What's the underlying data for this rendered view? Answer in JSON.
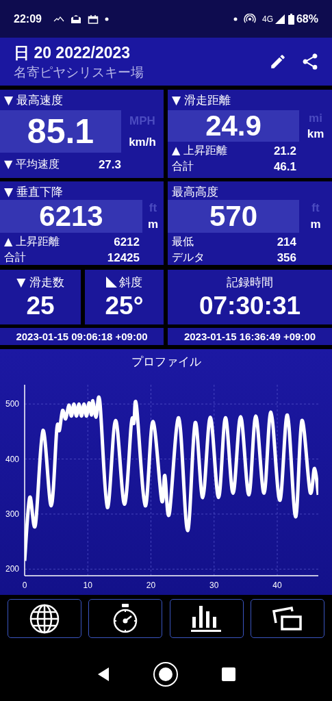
{
  "status_bar": {
    "time": "22:09",
    "network": "4G",
    "battery": "68%"
  },
  "header": {
    "title": "日 20 2022/2023",
    "subtitle": "名寄ピヤシリスキー場"
  },
  "stats": [
    {
      "label": "▼ 最高速度",
      "value": "85.1",
      "units": [
        {
          "label": "MPH",
          "selected": false
        },
        {
          "label": "km/h",
          "selected": true
        }
      ],
      "rows": [
        {
          "label": "▼ 平均速度",
          "value": "27.3"
        }
      ]
    },
    {
      "label": "▼ 滑走距離",
      "value": "24.9",
      "units": [
        {
          "label": "mi",
          "selected": false
        },
        {
          "label": "km",
          "selected": true
        }
      ],
      "rows": [
        {
          "label": "▲ 上昇距離",
          "value": "21.2"
        },
        {
          "label": "合計",
          "value": "46.1"
        }
      ]
    },
    {
      "label": "▼ 垂直下降",
      "value": "6213",
      "units": [
        {
          "label": "ft",
          "selected": false
        },
        {
          "label": "m",
          "selected": true
        }
      ],
      "rows": [
        {
          "label": "▲ 上昇距離",
          "value": "6212"
        },
        {
          "label": "合計",
          "value": "12425"
        }
      ]
    },
    {
      "label": "最高高度",
      "value": "570",
      "units": [
        {
          "label": "ft",
          "selected": false
        },
        {
          "label": "m",
          "selected": true
        }
      ],
      "rows": [
        {
          "label": "最低",
          "value": "214"
        },
        {
          "label": "デルタ",
          "value": "356"
        }
      ]
    }
  ],
  "summary": [
    {
      "kind": "plain",
      "label": "▼ 滑走数",
      "value": "25"
    },
    {
      "kind": "slope",
      "label": "斜度",
      "value": "25°"
    },
    {
      "kind": "plain",
      "label": "記録時間",
      "value": "07:30:31"
    }
  ],
  "dates": [
    "2023-01-15 09:06:18 +09:00",
    "2023-01-15 16:36:49 +09:00"
  ],
  "profile": {
    "title": "プロファイル",
    "chart_data": {
      "type": "line",
      "grid": true,
      "xlim": [
        0,
        46.5
      ],
      "ylim": [
        188,
        535
      ],
      "xticks": [
        0,
        10,
        20,
        30,
        40
      ],
      "yticks": [
        200,
        300,
        400,
        500
      ],
      "x": [
        0,
        0.8,
        1.7,
        2.9,
        4.2,
        5.1,
        5.5,
        6,
        6.5,
        7,
        7.4,
        7.8,
        8.2,
        8.6,
        9,
        9.4,
        9.8,
        10.2,
        10.6,
        10.8,
        11.3,
        11.9,
        13.1,
        14.4,
        15.8,
        16.9,
        17.3,
        17.7,
        19.1,
        20.3,
        21.7,
        22.2,
        22.9,
        24.4,
        25.8,
        27,
        28.2,
        29.4,
        30.7,
        31.8,
        33,
        34.2,
        35.5,
        36.6,
        37.9,
        39,
        40.4,
        41.6,
        42.9,
        43.9,
        45.2,
        45.9,
        46.5
      ],
      "series": [
        {
          "color": "#ffffff",
          "values": [
            215,
            330,
            280,
            452,
            315,
            455,
            452,
            488,
            473,
            498,
            478,
            500,
            478,
            500,
            478,
            500,
            478,
            502,
            480,
            506,
            476,
            505,
            312,
            470,
            318,
            465,
            465,
            498,
            315,
            468,
            325,
            370,
            300,
            475,
            270,
            466,
            330,
            476,
            330,
            475,
            338,
            477,
            335,
            478,
            338,
            485,
            325,
            480,
            295,
            470,
            340,
            383,
            335
          ]
        }
      ]
    }
  }
}
